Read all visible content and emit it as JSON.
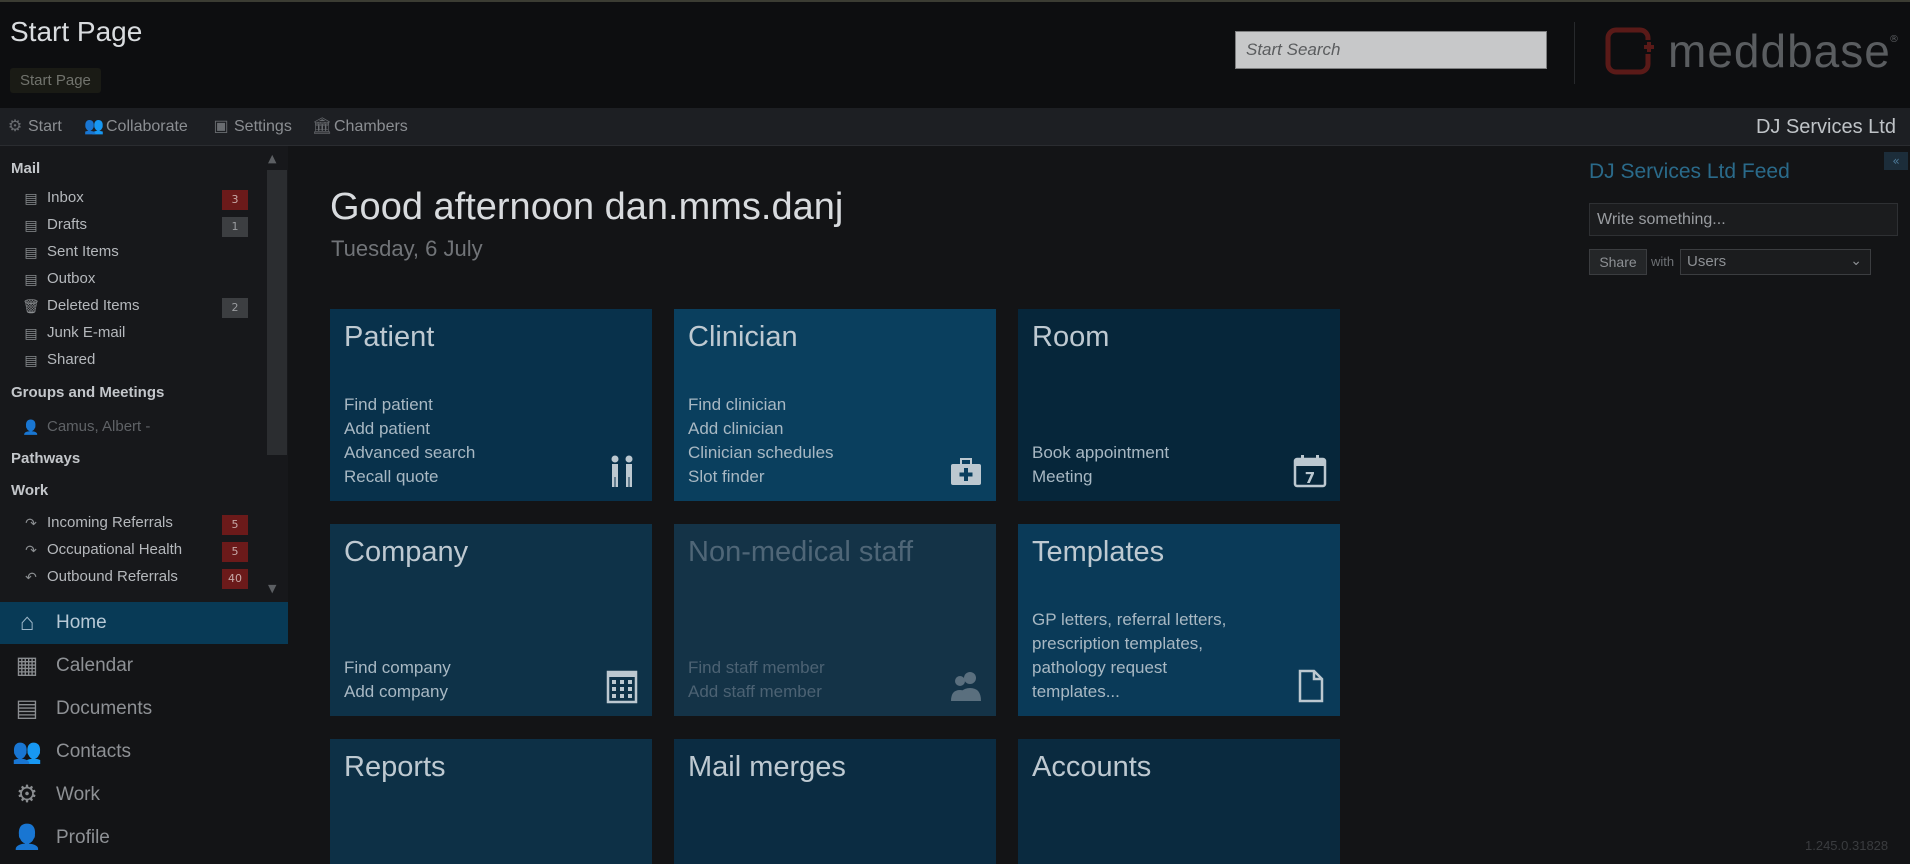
{
  "header": {
    "title": "Start Page",
    "breadcrumb": "Start Page",
    "search_placeholder": "Start Search",
    "logo_text": "meddbase",
    "logo_reg": "®"
  },
  "navbar": {
    "items": [
      {
        "label": "Start",
        "icon": "gear-icon"
      },
      {
        "label": "Collaborate",
        "icon": "people-icon"
      },
      {
        "label": "Settings",
        "icon": "settings-icon"
      },
      {
        "label": "Chambers",
        "icon": "building-icon"
      }
    ],
    "org_name": "DJ Services Ltd"
  },
  "sidebar": {
    "mail_header": "Mail",
    "mail": [
      {
        "label": "Inbox",
        "badge": "3",
        "badge_type": "red",
        "icon": "inbox-icon"
      },
      {
        "label": "Drafts",
        "badge": "1",
        "badge_type": "grey",
        "icon": "drafts-icon"
      },
      {
        "label": "Sent Items",
        "badge": "",
        "icon": "sent-icon"
      },
      {
        "label": "Outbox",
        "badge": "",
        "icon": "outbox-icon"
      },
      {
        "label": "Deleted Items",
        "badge": "2",
        "badge_type": "grey",
        "icon": "trash-icon"
      },
      {
        "label": "Junk E-mail",
        "badge": "",
        "icon": "junk-icon"
      },
      {
        "label": "Shared",
        "badge": "",
        "icon": "shared-icon"
      }
    ],
    "groups_header": "Groups and Meetings",
    "groups": [
      {
        "label": "Camus, Albert -",
        "icon": "person-icon"
      }
    ],
    "pathways_header": "Pathways",
    "work_header": "Work",
    "work": [
      {
        "label": "Incoming Referrals",
        "badge": "5",
        "icon": "arrow-forward-icon"
      },
      {
        "label": "Occupational Health",
        "badge": "5",
        "icon": "arrow-forward-icon"
      },
      {
        "label": "Outbound Referrals",
        "badge": "40",
        "icon": "arrow-back-icon"
      }
    ]
  },
  "bottomnav": {
    "items": [
      {
        "label": "Home",
        "icon": "home-icon",
        "active": true
      },
      {
        "label": "Calendar",
        "icon": "calendar-icon"
      },
      {
        "label": "Documents",
        "icon": "documents-icon"
      },
      {
        "label": "Contacts",
        "icon": "contacts-icon"
      },
      {
        "label": "Work",
        "icon": "gear-icon"
      },
      {
        "label": "Profile",
        "icon": "profile-icon"
      }
    ]
  },
  "main": {
    "greeting": "Good afternoon dan.mms.danj",
    "date": "Tuesday, 6 July",
    "tiles": [
      {
        "title": "Patient",
        "links": [
          "Find patient",
          "Add patient",
          "Advanced search",
          "Recall quote"
        ],
        "icon": "patients-icon",
        "color": "#08314b"
      },
      {
        "title": "Clinician",
        "links": [
          "Find clinician",
          "Add clinician",
          "Clinician schedules",
          "Slot finder"
        ],
        "icon": "medical-bag-icon",
        "color": "#0a3f5e"
      },
      {
        "title": "Room",
        "links": [
          "Book appointment",
          "Meeting"
        ],
        "icon": "calendar-icon",
        "color": "#06263a"
      },
      {
        "title": "Company",
        "links": [
          "Find company",
          "Add company"
        ],
        "icon": "building-icon",
        "color": "#0e3248"
      },
      {
        "title": "Non-medical staff",
        "links": [
          "Find staff member",
          "Add staff member"
        ],
        "icon": "staff-icon",
        "color": "#143347"
      },
      {
        "title": "Templates",
        "links": [
          "GP letters, referral letters,",
          "prescription templates,",
          "pathology request",
          "templates..."
        ],
        "icon": "document-icon",
        "color": "#0a3a58"
      },
      {
        "title": "Reports",
        "links": [],
        "icon": "",
        "color": "#0d3046"
      },
      {
        "title": "Mail merges",
        "links": [],
        "icon": "",
        "color": "#0b2c42"
      },
      {
        "title": "Accounts",
        "links": [],
        "icon": "",
        "color": "#0a2a3f"
      }
    ]
  },
  "feed": {
    "title": "DJ Services Ltd Feed",
    "input_placeholder": "Write something...",
    "share_label": "Share",
    "with_label": "with",
    "users_value": "Users",
    "collapse_label": "«"
  },
  "version": "1.245.0.31828"
}
